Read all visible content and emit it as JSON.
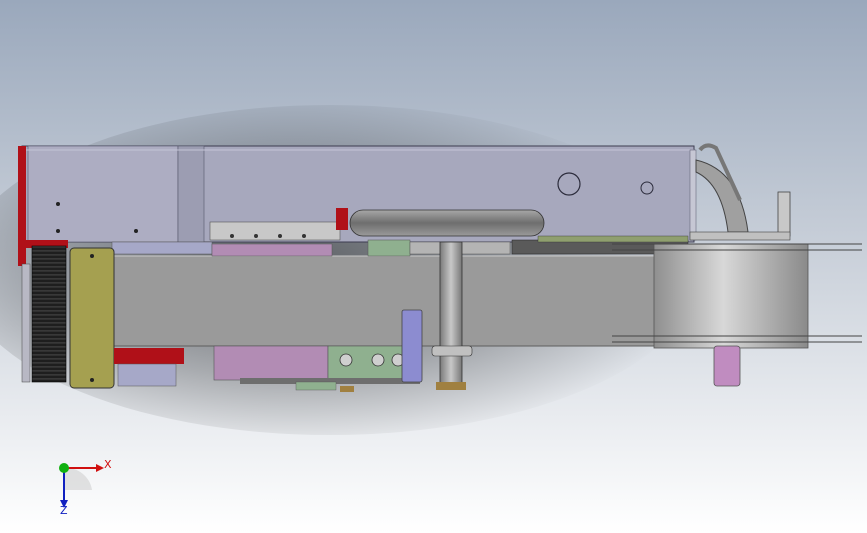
{
  "viewport": {
    "background_top": "#9aa8bc",
    "background_mid": "#c7ced8",
    "background_bottom": "#ffffff"
  },
  "triad": {
    "x_label": "X",
    "z_label": "Z",
    "x_color": "#d01010",
    "y_color": "#10b010",
    "z_color": "#1020c0"
  },
  "colors": {
    "housing": "#a7a8bd",
    "belt": "#9a9a9a",
    "red_part": "#b01018",
    "olive_plate": "#a5a050",
    "pulley": "#b0b0b0",
    "tube": "#8c8c8c",
    "purple_block": "#b28cb4",
    "green_block": "#8fb08f",
    "pink_pin": "#c08cc0",
    "blue_pin": "#8c8cd0",
    "heatsink": "#1e1e1e"
  },
  "icons": {
    "view_triad": "axis-triad-icon"
  }
}
